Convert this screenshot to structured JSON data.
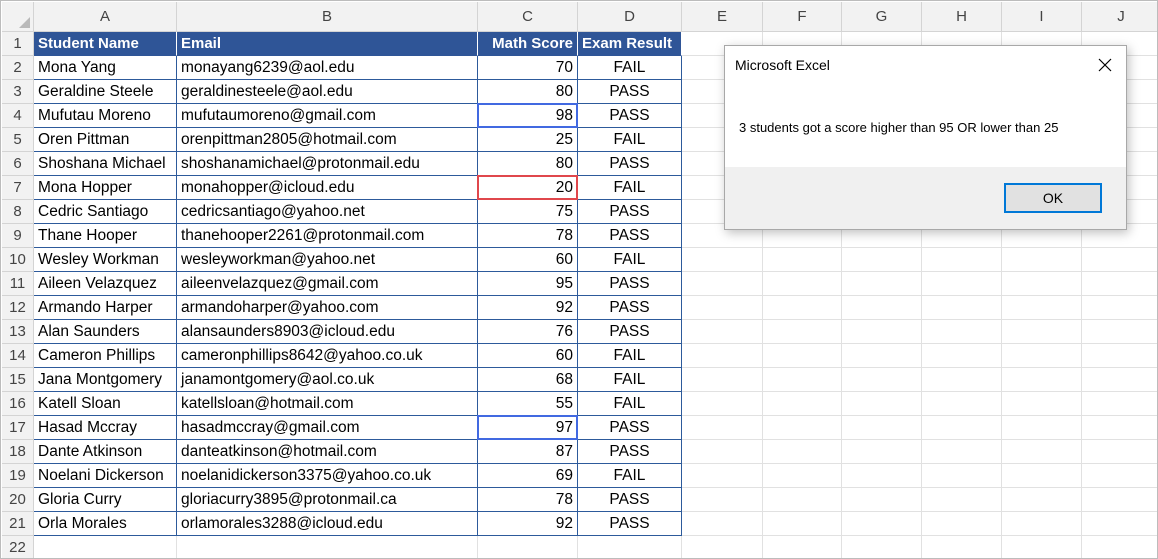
{
  "columns": [
    "A",
    "B",
    "C",
    "D",
    "E",
    "F",
    "G",
    "H",
    "I",
    "J"
  ],
  "headers": {
    "student_name": "Student Name",
    "email": "Email",
    "math_score": "Math Score",
    "exam_result": "Exam Result"
  },
  "rows": [
    {
      "row": "2",
      "name": "Mona Yang",
      "email": "monayang6239@aol.edu",
      "score": "70",
      "result": "FAIL"
    },
    {
      "row": "3",
      "name": "Geraldine Steele",
      "email": "geraldinesteele@aol.edu",
      "score": "80",
      "result": "PASS"
    },
    {
      "row": "4",
      "name": "Mufutau Moreno",
      "email": "mufutaumoreno@gmail.com",
      "score": "98",
      "result": "PASS"
    },
    {
      "row": "5",
      "name": "Oren Pittman",
      "email": "orenpittman2805@hotmail.com",
      "score": "25",
      "result": "FAIL"
    },
    {
      "row": "6",
      "name": "Shoshana Michael",
      "email": "shoshanamichael@protonmail.edu",
      "score": "80",
      "result": "PASS"
    },
    {
      "row": "7",
      "name": "Mona Hopper",
      "email": "monahopper@icloud.edu",
      "score": "20",
      "result": "FAIL"
    },
    {
      "row": "8",
      "name": "Cedric Santiago",
      "email": "cedricsantiago@yahoo.net",
      "score": "75",
      "result": "PASS"
    },
    {
      "row": "9",
      "name": "Thane Hooper",
      "email": "thanehooper2261@protonmail.com",
      "score": "78",
      "result": "PASS"
    },
    {
      "row": "10",
      "name": "Wesley Workman",
      "email": "wesleyworkman@yahoo.net",
      "score": "60",
      "result": "FAIL"
    },
    {
      "row": "11",
      "name": "Aileen Velazquez",
      "email": "aileenvelazquez@gmail.com",
      "score": "95",
      "result": "PASS"
    },
    {
      "row": "12",
      "name": "Armando Harper",
      "email": "armandoharper@yahoo.com",
      "score": "92",
      "result": "PASS"
    },
    {
      "row": "13",
      "name": "Alan Saunders",
      "email": "alansaunders8903@icloud.edu",
      "score": "76",
      "result": "PASS"
    },
    {
      "row": "14",
      "name": "Cameron Phillips",
      "email": "cameronphillips8642@yahoo.co.uk",
      "score": "60",
      "result": "FAIL"
    },
    {
      "row": "15",
      "name": "Jana Montgomery",
      "email": "janamontgomery@aol.co.uk",
      "score": "68",
      "result": "FAIL"
    },
    {
      "row": "16",
      "name": "Katell Sloan",
      "email": "katellsloan@hotmail.com",
      "score": "55",
      "result": "FAIL"
    },
    {
      "row": "17",
      "name": "Hasad Mccray",
      "email": "hasadmccray@gmail.com",
      "score": "97",
      "result": "PASS"
    },
    {
      "row": "18",
      "name": "Dante Atkinson",
      "email": "danteatkinson@hotmail.com",
      "score": "87",
      "result": "PASS"
    },
    {
      "row": "19",
      "name": "Noelani Dickerson",
      "email": "noelanidickerson3375@yahoo.co.uk",
      "score": "69",
      "result": "FAIL"
    },
    {
      "row": "20",
      "name": "Gloria Curry",
      "email": "gloriacurry3895@protonmail.ca",
      "score": "78",
      "result": "PASS"
    },
    {
      "row": "21",
      "name": "Orla Morales",
      "email": "orlamorales3288@icloud.edu",
      "score": "92",
      "result": "PASS"
    }
  ],
  "row_numbers": [
    "1",
    "2",
    "3",
    "4",
    "5",
    "6",
    "7",
    "8",
    "9",
    "10",
    "11",
    "12",
    "13",
    "14",
    "15",
    "16",
    "17",
    "18",
    "19",
    "20",
    "21",
    "22"
  ],
  "highlights": [
    {
      "cell": "C4",
      "color": "#4169e1"
    },
    {
      "cell": "C7",
      "color": "#e0474c"
    },
    {
      "cell": "C17",
      "color": "#4169e1"
    }
  ],
  "dialog": {
    "title": "Microsoft Excel",
    "message": "3 students got a score higher than 95 OR lower than 25",
    "ok_label": "OK",
    "close_icon": "close-icon"
  },
  "colors": {
    "header_fill": "#2f5597",
    "header_text": "#ffffff",
    "table_border": "#2d5a9b",
    "dialog_button_border": "#0078d7"
  }
}
